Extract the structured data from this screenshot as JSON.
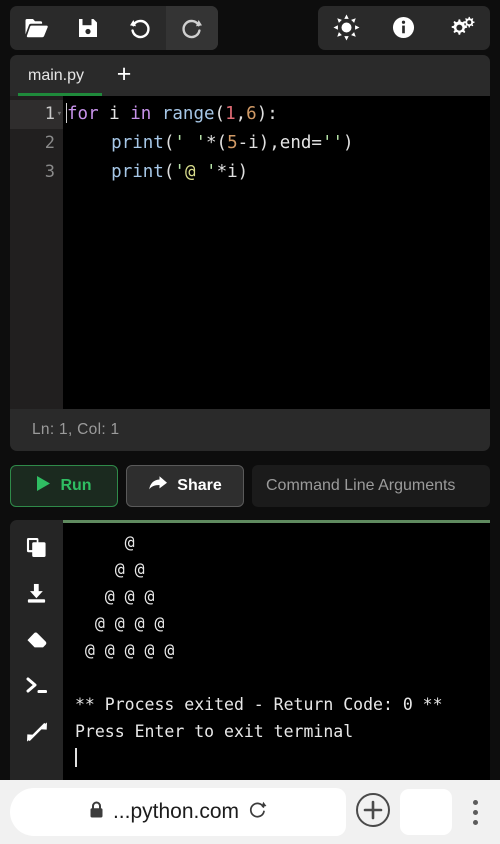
{
  "toolbar": {
    "left_buttons": [
      {
        "name": "open-file",
        "icon": "folder-open-icon"
      },
      {
        "name": "save-file",
        "icon": "save-disk-icon"
      },
      {
        "name": "undo",
        "icon": "undo-icon"
      },
      {
        "name": "redo",
        "icon": "redo-icon"
      }
    ],
    "right_buttons": [
      {
        "name": "theme-brightness",
        "icon": "sun-icon"
      },
      {
        "name": "info",
        "icon": "info-circle-icon"
      },
      {
        "name": "settings",
        "icon": "gears-icon"
      }
    ]
  },
  "tabs": {
    "files": [
      {
        "label": "main.py",
        "active": true
      }
    ],
    "add_label": "+"
  },
  "editor": {
    "line_numbers": [
      "1",
      "2",
      "3"
    ],
    "fold_marker": "▾",
    "lines": [
      {
        "tokens": [
          {
            "t": "for",
            "c": "t-kw"
          },
          {
            "t": " i ",
            "c": "t-var"
          },
          {
            "t": "in",
            "c": "t-kw"
          },
          {
            "t": " ",
            "c": "t-var"
          },
          {
            "t": "range",
            "c": "t-fn"
          },
          {
            "t": "(",
            "c": "t-punct"
          },
          {
            "t": "1",
            "c": "t-num1"
          },
          {
            "t": ",",
            "c": "t-punct"
          },
          {
            "t": "6",
            "c": "t-num2"
          },
          {
            "t": "):",
            "c": "t-punct"
          }
        ]
      },
      {
        "tokens": [
          {
            "t": "    ",
            "c": "t-var"
          },
          {
            "t": "print",
            "c": "t-fn"
          },
          {
            "t": "(",
            "c": "t-punct"
          },
          {
            "t": "' '",
            "c": "t-str"
          },
          {
            "t": "*(",
            "c": "t-punct"
          },
          {
            "t": "5",
            "c": "t-num2"
          },
          {
            "t": "-i),",
            "c": "t-punct"
          },
          {
            "t": "end",
            "c": "t-var"
          },
          {
            "t": "=",
            "c": "t-punct"
          },
          {
            "t": "''",
            "c": "t-str"
          },
          {
            "t": ")",
            "c": "t-punct"
          }
        ]
      },
      {
        "tokens": [
          {
            "t": "    ",
            "c": "t-var"
          },
          {
            "t": "print",
            "c": "t-fn"
          },
          {
            "t": "(",
            "c": "t-punct"
          },
          {
            "t": "'",
            "c": "t-str"
          },
          {
            "t": "@",
            "c": "t-at"
          },
          {
            "t": " '",
            "c": "t-str"
          },
          {
            "t": "*i)",
            "c": "t-punct"
          }
        ]
      }
    ],
    "raw_code": "for i in range(1,6):\n    print(' '*(5-i),end='')\n    print('@ '*i)"
  },
  "status": {
    "text": "Ln: 1,  Col: 1"
  },
  "actions": {
    "run_label": "Run",
    "run_icon": "play-triangle-icon",
    "share_label": "Share",
    "share_icon": "share-arrow-icon",
    "cla_placeholder": "Command Line Arguments",
    "cla_value": ""
  },
  "output_sidebar": {
    "buttons": [
      {
        "name": "copy-output",
        "icon": "copy-icon"
      },
      {
        "name": "download-output",
        "icon": "download-icon"
      },
      {
        "name": "clear-output",
        "icon": "eraser-icon"
      },
      {
        "name": "open-terminal",
        "icon": "terminal-prompt-icon"
      },
      {
        "name": "expand-output",
        "icon": "expand-arrows-icon"
      }
    ]
  },
  "terminal": {
    "lines": [
      "     @",
      "    @ @",
      "   @ @ @",
      "  @ @ @ @",
      " @ @ @ @ @",
      "",
      "** Process exited - Return Code: 0 **",
      "Press Enter to exit terminal"
    ]
  },
  "browser": {
    "lock_icon": "lock-icon",
    "url": "...python.com",
    "reload_icon": "reload-icon",
    "newtab_icon": "plus-circle-icon",
    "menu_icon": "kebab-menu-icon"
  },
  "colors": {
    "accent_green": "#2fbd62",
    "tab_underline": "#1f8a3b",
    "terminal_border": "#5f8a5f",
    "panel_bg": "#2a2a2a",
    "editor_bg": "#000000",
    "gutter_bg": "#211f1f",
    "browser_bg": "#f1f1f1"
  }
}
